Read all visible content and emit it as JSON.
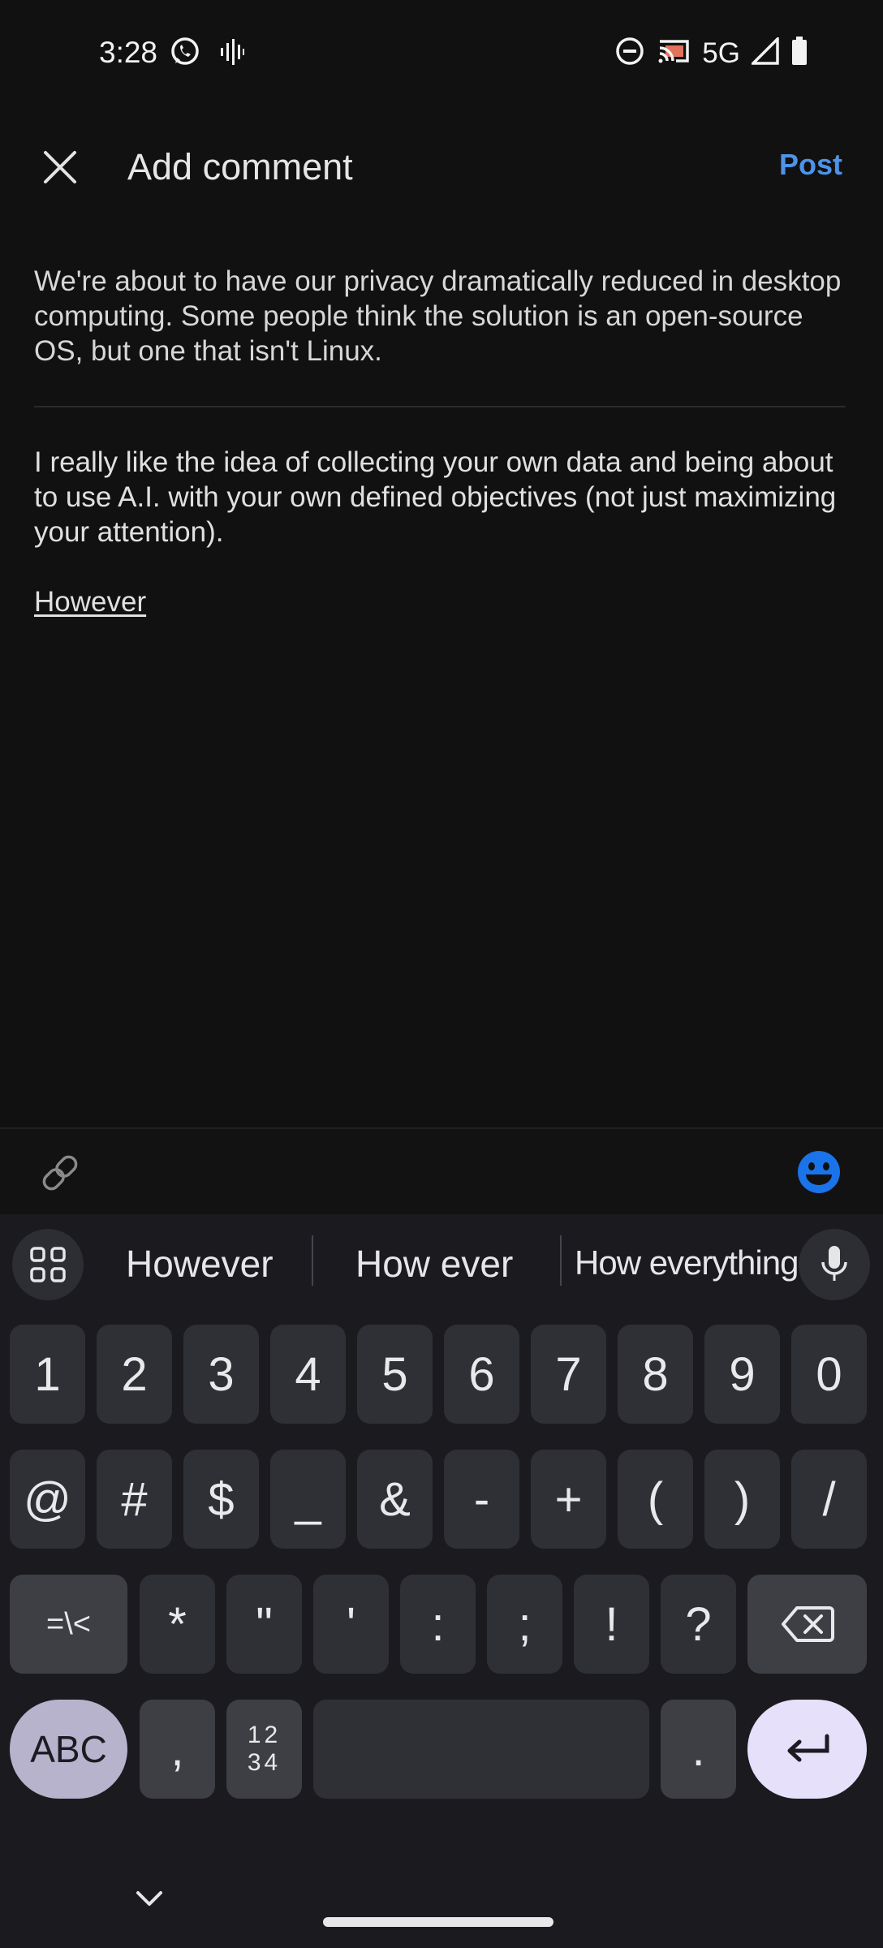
{
  "status_bar": {
    "time": "3:28",
    "network": "5G",
    "icons": [
      "whatsapp-icon",
      "audio-wave-icon",
      "do-not-disturb-icon",
      "cast-icon",
      "signal-icon",
      "battery-icon"
    ]
  },
  "header": {
    "title": "Add comment",
    "post_label": "Post"
  },
  "quoted_post": {
    "text": "We're about to have our privacy dramatically reduced in desktop computing. Some people think the solution is an open-source OS, but one that isn't Linux."
  },
  "comment": {
    "paragraph1": "I really like the idea of collecting your own data and being about to use A.I. with your own defined objectives (not just maximizing your attention).",
    "paragraph2": "However"
  },
  "keyboard": {
    "suggestions": [
      "However",
      "How ever",
      "How everything"
    ],
    "row_numbers": [
      "1",
      "2",
      "3",
      "4",
      "5",
      "6",
      "7",
      "8",
      "9",
      "0"
    ],
    "row_symbols1": [
      "@",
      "#",
      "$",
      "_",
      "&",
      "-",
      "+",
      "(",
      ")",
      "/"
    ],
    "shift_symbols_label": "=\\<",
    "row_symbols2": [
      "*",
      "\"",
      "'",
      ":",
      ";",
      "!",
      "?"
    ],
    "abc_label": "ABC",
    "comma": ",",
    "numpad_label_top": "12",
    "numpad_label_bottom": "34",
    "period": "."
  },
  "colors": {
    "background": "#111112",
    "accent": "#4d93e8",
    "keyboard": "#1b1b1f",
    "key": "#2f3035",
    "abc_key": "#b8b3cc",
    "enter_key": "#e6e0fa",
    "emoji": "#1a73e8"
  }
}
